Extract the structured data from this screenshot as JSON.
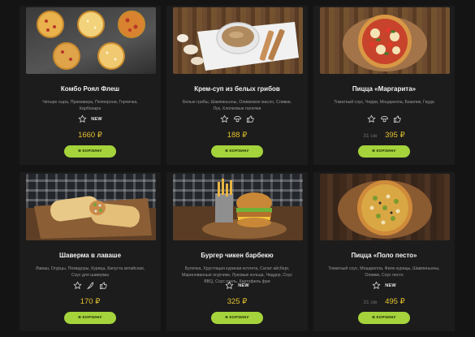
{
  "products": [
    {
      "title": "Комбо Роял Флеш",
      "description": "Четыре сыра, Примавера, Пепперони, Горчичка, Карбонара",
      "icons": [
        "star-outline-icon"
      ],
      "badge": "NEW",
      "old_price": "",
      "price": "1660 ₽",
      "button": "В КОРЗИНУ"
    },
    {
      "title": "Крем-суп из белых грибов",
      "description": "Белые грибы, Шампиньоны, Оливковое масло, Сливки, Лук, Хлопковые палочки",
      "icons": [
        "star-outline-icon",
        "mushroom-icon",
        "thumbs-up-icon"
      ],
      "badge": "",
      "old_price": "",
      "price": "188 ₽",
      "button": "В КОРЗИНУ"
    },
    {
      "title": "Пицца «Маргарита»",
      "description": "Томатный соус, Черри, Моцарелла, Базилик, Гауда",
      "icons": [
        "star-outline-icon",
        "mushroom-icon",
        "thumbs-up-icon"
      ],
      "badge": "",
      "old_price": "31 см",
      "price": "395 ₽",
      "button": "В КОРЗИНУ"
    },
    {
      "title": "Шаверма в лаваше",
      "description": "Лаваш, Огурцы, Помидоры, Курица, Капуста китайская, Соус для шавермы",
      "icons": [
        "star-outline-icon",
        "chili-pepper-icon",
        "thumbs-up-icon"
      ],
      "badge": "",
      "old_price": "",
      "price": "170 ₽",
      "button": "В КОРЗИНУ"
    },
    {
      "title": "Бургер чикен барбекю",
      "description": "Булочка, Хрустящая куриная котлета, Салат айсберг, Маринованные огурчики, Луковые кольца, Чеддер, Соус BBQ, Соус гриль, Картофель фри",
      "icons": [
        "star-outline-icon"
      ],
      "badge": "NEW",
      "old_price": "",
      "price": "325 ₽",
      "button": "В КОРЗИНУ"
    },
    {
      "title": "Пицца «Поло песто»",
      "description": "Томатный соус, Моцарелла, Филе курицы, Шампиньоны, Оливки, Соус песто",
      "icons": [
        "star-outline-icon"
      ],
      "badge": "NEW",
      "old_price": "31 см",
      "price": "495 ₽",
      "button": "В КОРЗИНУ"
    }
  ],
  "colors": {
    "background": "#141414",
    "card": "#1c1c1c",
    "price": "#e3c02f",
    "button": "#a5d33c"
  }
}
